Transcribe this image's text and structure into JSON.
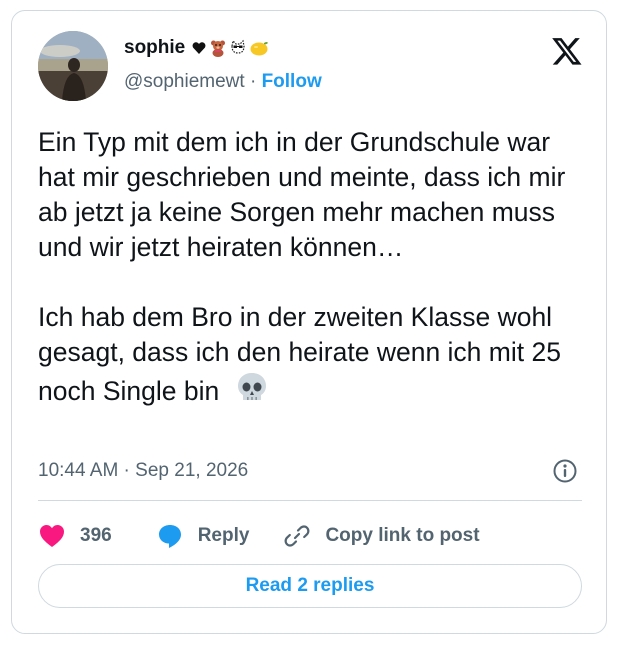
{
  "author": {
    "display_name": "sophie",
    "badges": [
      "black-heart-emoji",
      "teddy-bear-emoji",
      "dotted-cat-emoji",
      "lemon-emoji"
    ],
    "handle": "@sophiemewt",
    "separator": "·",
    "follow_label": "Follow",
    "avatar": "profile-photo-sunset-sea"
  },
  "tweet": {
    "text": "Ein Typ mit dem ich in der Grundschule war hat mir geschrieben und meinte, dass ich mir ab jetzt ja keine Sorgen mehr machen muss und wir jetzt heiraten können…\n\nIch hab dem Bro in der zweiten Klasse wohl gesagt, dass ich den heirate wenn ich mit 25 noch Single bin",
    "trailing_emoji": "skull-emoji",
    "timestamp": "10:44 AM · Sep 21, 2026"
  },
  "actions": {
    "likes_count": "396",
    "reply_label": "Reply",
    "copy_label": "Copy link to post"
  },
  "read_replies_label": "Read 2 replies",
  "colors": {
    "accent": "#1d9bf0",
    "like": "#f91880",
    "text": "#0f1419",
    "muted": "#536471",
    "border": "#cfd9de"
  }
}
